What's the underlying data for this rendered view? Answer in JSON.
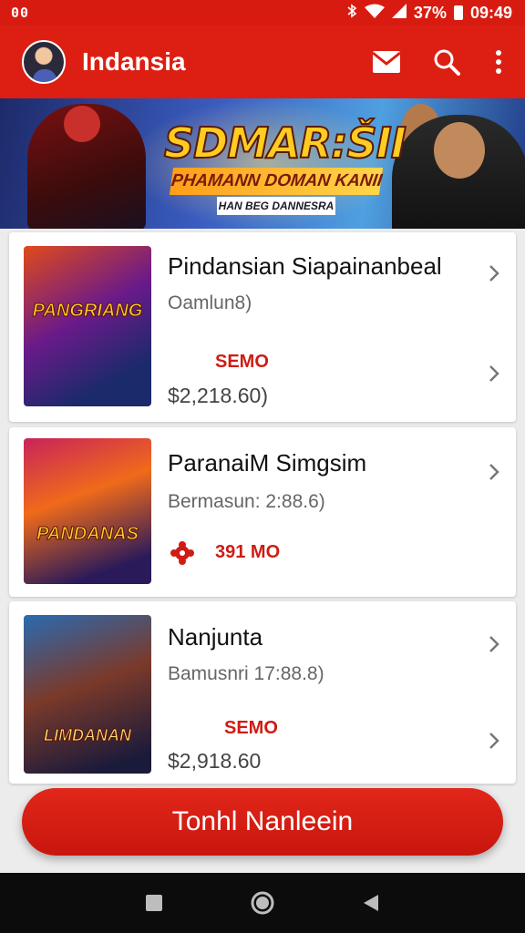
{
  "status_bar": {
    "left_text": "00",
    "battery": "37%",
    "time": "09:49",
    "icons": [
      "bluetooth-icon",
      "wifi-icon",
      "signal-icon",
      "battery-icon"
    ]
  },
  "app_bar": {
    "title": "Indansia",
    "icons": [
      "mail-icon",
      "search-icon",
      "more-vert-icon"
    ]
  },
  "banner": {
    "title": "SDMAR:ŠII",
    "subtitle": "PHAMANN DOMAN KANII",
    "small_text": "HAN BEG DANNESRA"
  },
  "items": [
    {
      "title": "Pindansian Siapainanbeal",
      "subtitle": "Oamlun8)",
      "tag": "SEMO",
      "price": "$2,218.60)",
      "thumb_text": "PANGRIANG"
    },
    {
      "title": "ParanaiM Simgsim",
      "subtitle": "Bermasun: 2:88.6)",
      "tag": "391 MO",
      "price": "",
      "thumb_text": "PANDANAS"
    },
    {
      "title": "Nanjunta",
      "subtitle": "Bamusnri 17:88.8)",
      "tag": "SEMO",
      "price": "$2,918.60",
      "thumb_text": "LIMDANAN"
    }
  ],
  "cta": {
    "label": "Tonhl Nanleein"
  },
  "nav": [
    "recents-square-icon",
    "home-circle-icon",
    "back-triangle-icon"
  ],
  "colors": {
    "primary": "#dc1f12",
    "tag_red": "#cf1c14"
  }
}
